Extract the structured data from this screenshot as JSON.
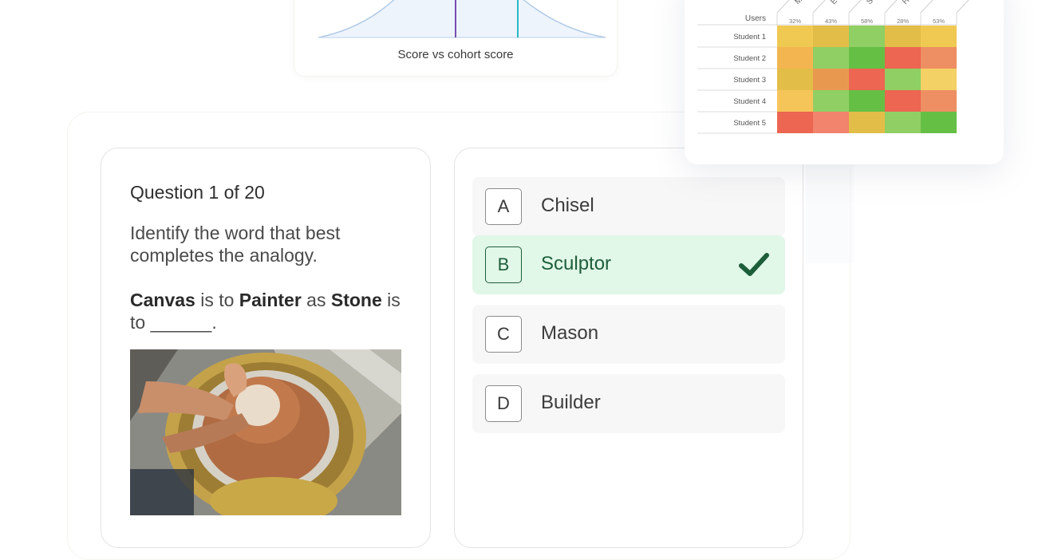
{
  "distribution_chart": {
    "caption": "Score vs cohort score",
    "colors": {
      "curve": "#b9d0ea",
      "fill": "#eaf2fb",
      "band": "#dbe8f7",
      "line_score": "#7a4fb0",
      "line_cohort": "#23b9c4"
    }
  },
  "question": {
    "number_label": "Question 1 of 20",
    "prompt": "Identify the word that best completes the analogy.",
    "analogy": {
      "w1": "Canvas",
      "t1": " is to ",
      "w2": "Painter",
      "t2": " as ",
      "w3": "Stone",
      "t3": " is to ______."
    },
    "image_desc": "pottery-wheel-photo"
  },
  "answers": {
    "options": [
      {
        "letter": "A",
        "text": "Chisel",
        "selected": false
      },
      {
        "letter": "B",
        "text": "Sculptor",
        "selected": true
      },
      {
        "letter": "C",
        "text": "Mason",
        "selected": false
      },
      {
        "letter": "D",
        "text": "Builder",
        "selected": false
      }
    ],
    "correct_icon": "check-icon",
    "colors": {
      "selected_bg": "#e1f7e8",
      "selected_fg": "#1d5e3a"
    }
  },
  "heatmap": {
    "header_label": "Users",
    "column_percents": [
      "32%",
      "43%",
      "58%",
      "28%",
      "53%"
    ],
    "column_header_fragments": [
      "M",
      "E",
      "S",
      "H",
      ""
    ],
    "rows": [
      {
        "label": "Student 1",
        "colors": [
          "#f0c952",
          "#e2bd47",
          "#8fcf63",
          "#e2bd47",
          "#f0c952"
        ]
      },
      {
        "label": "Student 2",
        "colors": [
          "#f2b54f",
          "#8fcf63",
          "#66bf45",
          "#ec6651",
          "#ee8f63"
        ]
      },
      {
        "label": "Student 3",
        "colors": [
          "#e2bd47",
          "#e8994f",
          "#ec6651",
          "#8fcf63",
          "#f4d165"
        ]
      },
      {
        "label": "Student 4",
        "colors": [
          "#f6c55a",
          "#8fcf63",
          "#66bf45",
          "#ec6651",
          "#ee8f63"
        ]
      },
      {
        "label": "Student 5",
        "colors": [
          "#ec6651",
          "#f2836c",
          "#e2bd47",
          "#8fcf63",
          "#66bf45"
        ]
      }
    ]
  }
}
